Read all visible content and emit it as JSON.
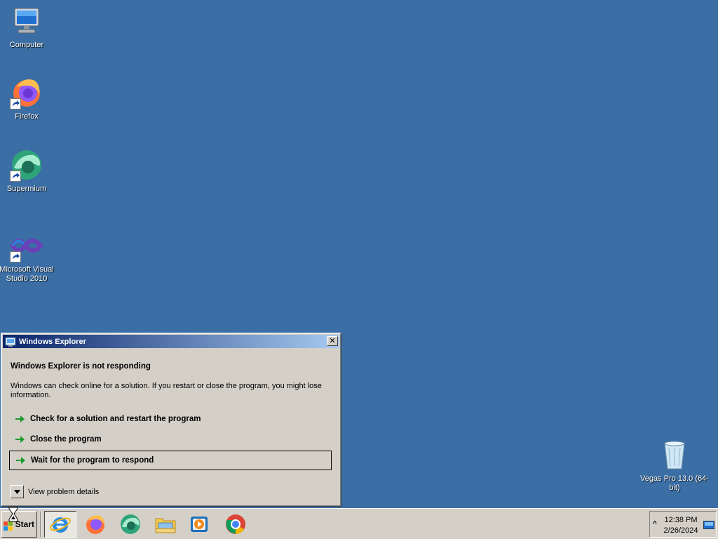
{
  "desktop": {
    "icons": [
      {
        "name": "Computer"
      },
      {
        "name": "Firefox"
      },
      {
        "name": "Supermium"
      },
      {
        "name": "Microsoft Visual Studio 2010"
      },
      {
        "name": "Vegas Pro 13.0 (64-bit)"
      }
    ],
    "background_color": "#3a6ea5"
  },
  "dialog": {
    "title": "Windows Explorer",
    "heading": "Windows Explorer is not responding",
    "body": "Windows can check online for a solution. If you restart or close the program, you might lose information.",
    "commands": [
      {
        "label": "Check for a solution and restart the program"
      },
      {
        "label": "Close the program"
      },
      {
        "label": "Wait for the program to respond"
      }
    ],
    "details_label": "View problem details",
    "close_glyph": "✕"
  },
  "taskbar": {
    "start_label": "Start",
    "apps": [
      {
        "icon": "internet-explorer-icon"
      },
      {
        "icon": "firefox-icon"
      },
      {
        "icon": "supermium-icon"
      },
      {
        "icon": "file-explorer-icon"
      },
      {
        "icon": "media-player-icon"
      },
      {
        "icon": "chrome-icon"
      }
    ],
    "tray": {
      "time": "12:38 PM",
      "date": "2/26/2024"
    }
  },
  "colors": {
    "title_gradient_start": "#0a246a",
    "title_gradient_end": "#a6caf0",
    "chrome_face": "#d4d0c8",
    "command_arrow": "#1d9a2c"
  }
}
